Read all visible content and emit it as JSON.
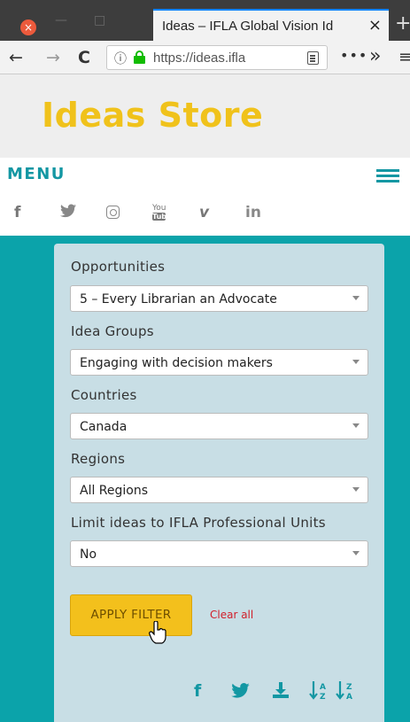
{
  "browser": {
    "tab_title": "Ideas – IFLA Global Vision Id",
    "tab_close": "×",
    "new_tab": "+",
    "url": "https://ideas.ifla",
    "back": "←",
    "forward": "→",
    "reload": "C",
    "info": "ⓘ",
    "page_actions": "•••",
    "overflow": "»",
    "menu": "≡"
  },
  "site": {
    "logo": "Ideas Store",
    "menu_label": "MENU",
    "social": [
      "f",
      "twitter",
      "instagram",
      "You Tube",
      "v",
      "in"
    ]
  },
  "filters": [
    {
      "label": "Opportunities",
      "value": "5 – Every Librarian an Advocate"
    },
    {
      "label": "Idea Groups",
      "value": "Engaging with decision makers"
    },
    {
      "label": "Countries",
      "value": "Canada"
    },
    {
      "label": "Regions",
      "value": "All Regions"
    },
    {
      "label": "Limit ideas to IFLA Professional Units",
      "value": "No"
    }
  ],
  "actions": {
    "apply": "APPLY FILTER",
    "clear": "Clear all"
  },
  "share": {
    "facebook": "f",
    "sort_az": "A Z",
    "sort_za": "Z A"
  },
  "colors": {
    "page_bg": "#0ba3aa",
    "panel_bg": "#c8dee5",
    "accent": "#1397a3",
    "logo": "#f0c21b",
    "button": "#f3c01c",
    "clear_link": "#d11f2a"
  }
}
